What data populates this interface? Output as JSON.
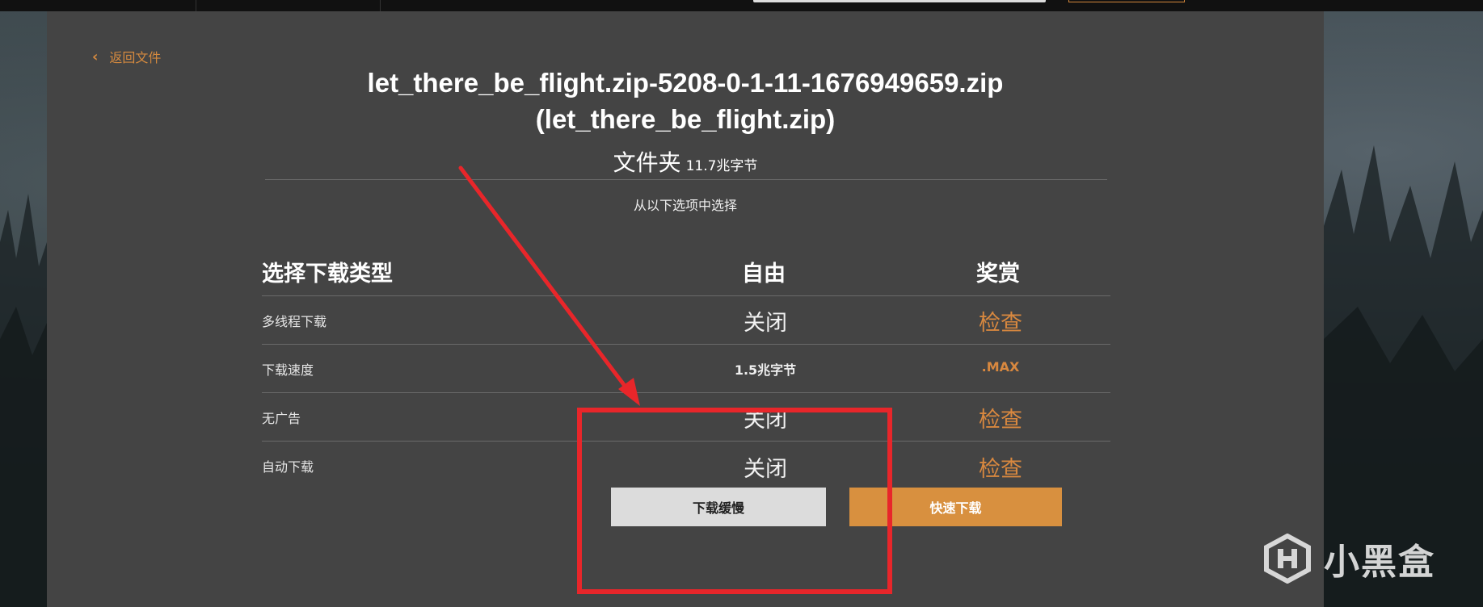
{
  "back_link": {
    "label": "返回文件"
  },
  "file": {
    "name_line1": "let_there_be_flight.zip-5208-0-1-11-1676949659.zip",
    "name_line2": "(let_there_be_flight.zip)",
    "type": "文件夹",
    "size": "11.7兆字节"
  },
  "choose_text": "从以下选项中选择",
  "table": {
    "headers": {
      "type": "选择下载类型",
      "free": "自由",
      "premium": "奖赏"
    },
    "rows": [
      {
        "label": "多线程下载",
        "free": "关闭",
        "premium": "检查"
      },
      {
        "label": "下载速度",
        "free": "1.5兆字节",
        "premium": ".MAX"
      },
      {
        "label": "无广告",
        "free": "关闭",
        "premium": "检查"
      },
      {
        "label": "自动下载",
        "free": "关闭",
        "premium": "检查"
      }
    ]
  },
  "buttons": {
    "slow": "下载缓慢",
    "fast": "快速下载"
  },
  "watermark": {
    "text": "小黑盒"
  },
  "colors": {
    "accent": "#d8903f",
    "highlight": "#e8262a",
    "panel": "#444444"
  }
}
